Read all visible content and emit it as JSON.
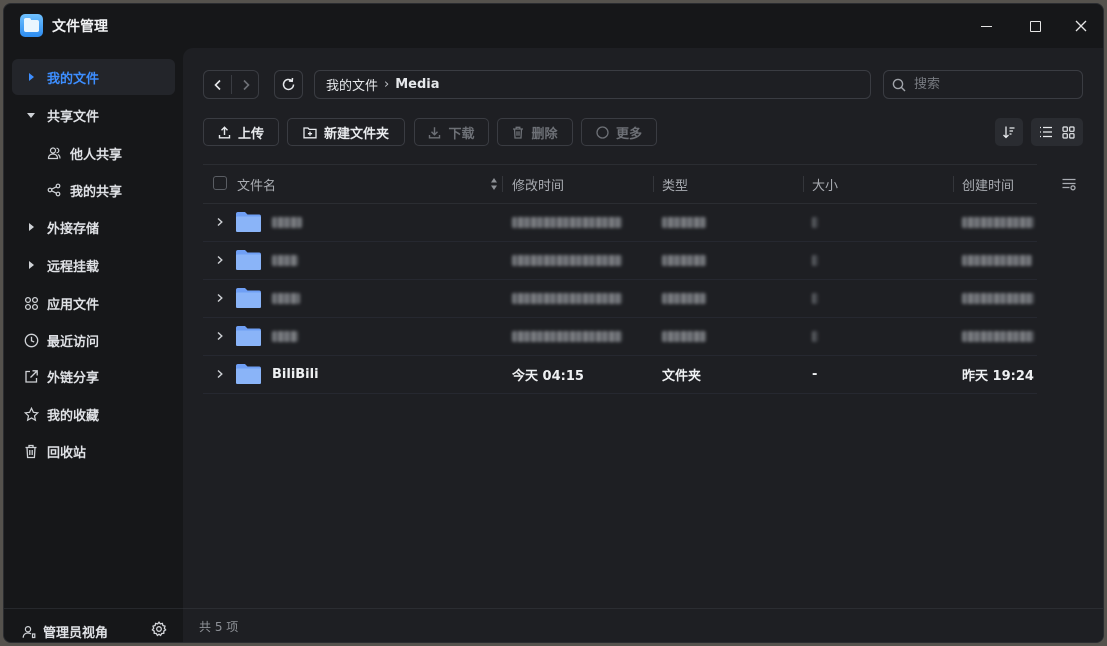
{
  "app": {
    "title": "文件管理"
  },
  "sidebar": {
    "items": [
      {
        "label": "我的文件",
        "icon": "caret-right-icon",
        "active": true
      },
      {
        "label": "共享文件",
        "icon": "caret-down-icon"
      },
      {
        "label": "他人共享",
        "icon": "users-icon"
      },
      {
        "label": "我的共享",
        "icon": "share-nodes-icon"
      },
      {
        "label": "外接存储",
        "icon": "caret-right-icon"
      },
      {
        "label": "远程挂载",
        "icon": "caret-right-icon"
      },
      {
        "label": "应用文件",
        "icon": "apps-icon"
      },
      {
        "label": "最近访问",
        "icon": "clock-icon"
      },
      {
        "label": "外链分享",
        "icon": "external-link-icon"
      },
      {
        "label": "我的收藏",
        "icon": "star-icon"
      },
      {
        "label": "回收站",
        "icon": "trash-icon"
      }
    ],
    "footer": {
      "admin_label": "管理员视角"
    }
  },
  "breadcrumb": {
    "root": "我的文件",
    "separator": "›",
    "current": "Media"
  },
  "search": {
    "placeholder": "搜索"
  },
  "toolbar": {
    "upload": "上传",
    "new_folder": "新建文件夹",
    "download": "下载",
    "delete": "删除",
    "more": "更多"
  },
  "table": {
    "columns": [
      "文件名",
      "修改时间",
      "类型",
      "大小",
      "创建时间"
    ],
    "rows": [
      {
        "name": "",
        "modified": "",
        "type": "",
        "size": "",
        "created": "",
        "redacted": true
      },
      {
        "name": "",
        "modified": "",
        "type": "",
        "size": "",
        "created": "",
        "redacted": true
      },
      {
        "name": "",
        "modified": "",
        "type": "",
        "size": "",
        "created": "",
        "redacted": true
      },
      {
        "name": "",
        "modified": "",
        "type": "",
        "size": "",
        "created": "",
        "redacted": true
      },
      {
        "name": "BiliBili",
        "modified": "今天 04:15",
        "type": "文件夹",
        "size": "-",
        "created": "昨天 19:24",
        "redacted": false
      }
    ]
  },
  "status": {
    "count_text": "共 5 项"
  },
  "colors": {
    "accent": "#3d8eff",
    "folder": "#8ab4f8",
    "background": "#1e1f23",
    "sidebar": "#161719"
  }
}
